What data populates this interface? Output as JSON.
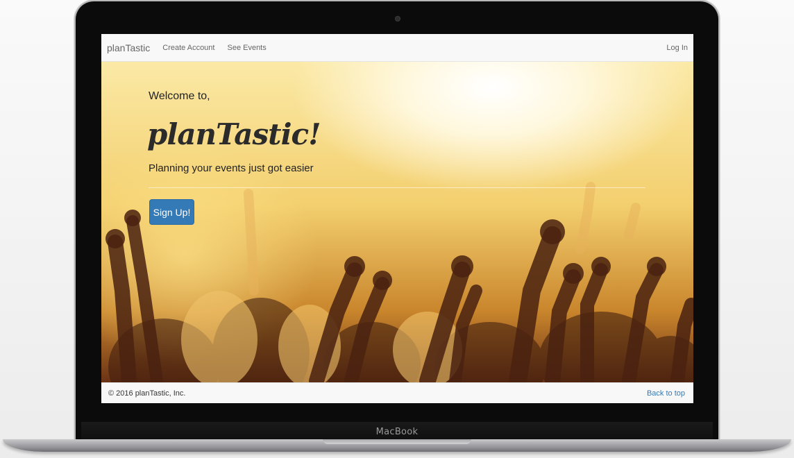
{
  "device": {
    "label": "MacBook"
  },
  "navbar": {
    "brand": "planTastic",
    "links": [
      "Create Account",
      "See Events"
    ],
    "login": "Log In"
  },
  "hero": {
    "welcome": "Welcome to,",
    "title": "planTastic!",
    "tagline": "Planning your events just got easier",
    "signup_label": "Sign Up!"
  },
  "footer": {
    "copyright": "© 2016 planTastic, Inc.",
    "back_to_top": "Back to top"
  },
  "colors": {
    "primary_button": "#337ab7",
    "link": "#337ab7",
    "navbar_bg": "#f8f8f8"
  }
}
